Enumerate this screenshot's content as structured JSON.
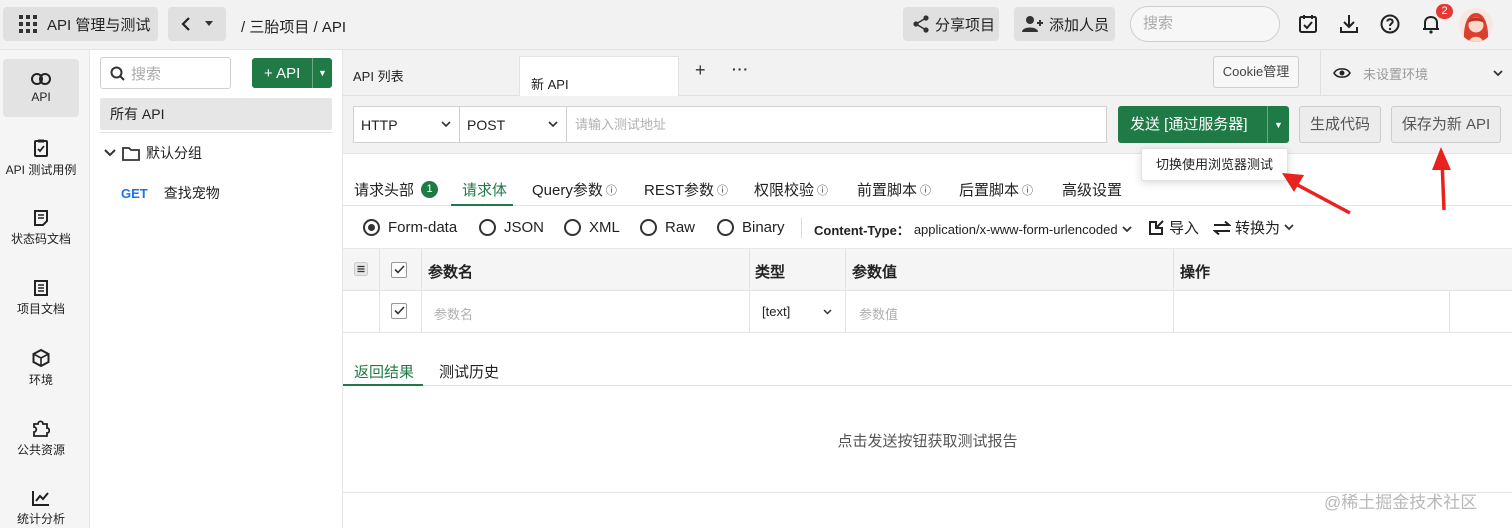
{
  "topbar": {
    "app_title": "API 管理与测试",
    "breadcrumb": "/ 三胎项目 / API",
    "share_label": "分享项目",
    "add_member_label": "添加人员",
    "search_placeholder": "搜索",
    "notification_count": "2"
  },
  "rail": {
    "items": [
      {
        "label": "API",
        "icon": "link-icon"
      },
      {
        "label": "API 测试用例",
        "icon": "clipboard-check-icon"
      },
      {
        "label": "状态码文档",
        "icon": "file-text-icon"
      },
      {
        "label": "项目文档",
        "icon": "document-icon"
      },
      {
        "label": "环境",
        "icon": "cube-icon"
      },
      {
        "label": "公共资源",
        "icon": "puzzle-icon"
      },
      {
        "label": "统计分析",
        "icon": "chart-line-icon"
      }
    ]
  },
  "tree": {
    "search_placeholder": "搜索",
    "add_api_label": "+ API",
    "all_api": "所有 API",
    "group_name": "默认分组",
    "api_item": {
      "method": "GET",
      "name": "查找宠物"
    }
  },
  "tabs": {
    "list_label": "API 列表",
    "new_label": "新 API",
    "plus": "+",
    "more": "···",
    "cookie_label": "Cookie管理",
    "env_label": "未设置环境"
  },
  "request": {
    "protocol": "HTTP",
    "method": "POST",
    "url_placeholder": "请输入测试地址",
    "send_label": "发送 [通过服务器]",
    "gen_code_label": "生成代码",
    "save_new_label": "保存为新 API",
    "dropdown_option": "切换使用浏览器测试"
  },
  "req_tabs": [
    {
      "label": "请求头部",
      "badge": "1"
    },
    {
      "label": "请求体"
    },
    {
      "label": "Query参数",
      "info": "ⓘ"
    },
    {
      "label": "REST参数",
      "info": "ⓘ"
    },
    {
      "label": "权限校验",
      "info": "ⓘ"
    },
    {
      "label": "前置脚本",
      "info": "ⓘ"
    },
    {
      "label": "后置脚本",
      "info": "ⓘ"
    },
    {
      "label": "高级设置"
    }
  ],
  "body_types": {
    "options": [
      "Form-data",
      "JSON",
      "XML",
      "Raw",
      "Binary"
    ],
    "selected": "Form-data",
    "content_type_label": "Content-Type：",
    "content_type_value": "application/x-www-form-urlencoded",
    "import_label": "导入",
    "convert_label": "转换为"
  },
  "params": {
    "headers": {
      "name": "参数名",
      "type": "类型",
      "value": "参数值",
      "action": "操作"
    },
    "row": {
      "name_placeholder": "参数名",
      "type": "[text]",
      "value_placeholder": "参数值"
    }
  },
  "response": {
    "tab_result": "返回结果",
    "tab_history": "测试历史",
    "empty_text": "点击发送按钮获取测试报告"
  },
  "watermark": "@稀土掘金技术社区",
  "colors": {
    "accent": "#1f7a45",
    "badge": "#e53935",
    "arrow": "#e8231f"
  }
}
